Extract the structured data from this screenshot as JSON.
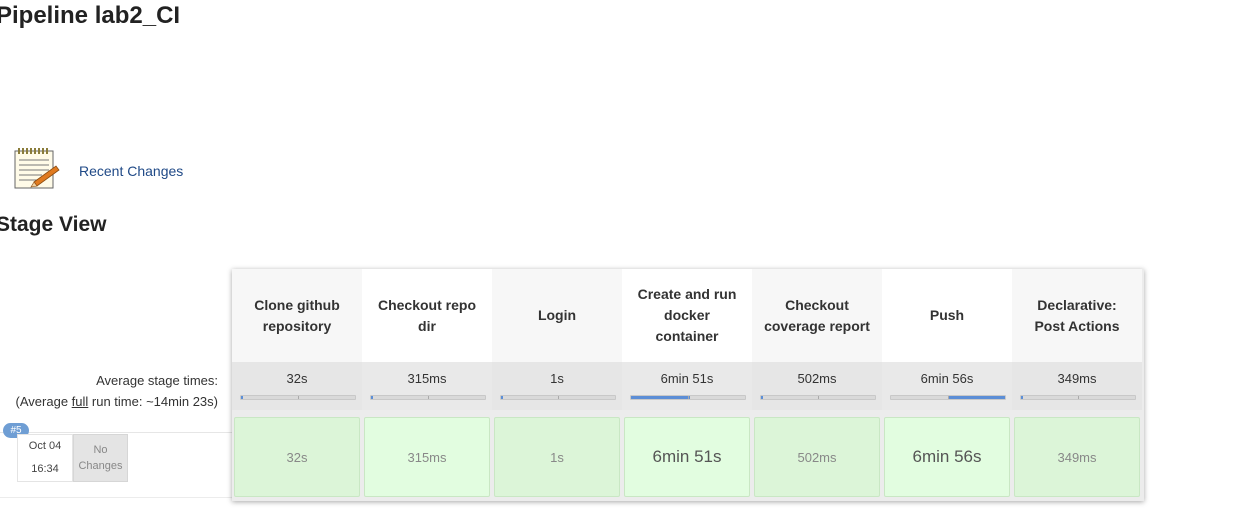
{
  "page": {
    "title": "Pipeline lab2_CI"
  },
  "recent_changes": {
    "label": "Recent Changes",
    "icon": "notepad-pencil-icon"
  },
  "stage_view": {
    "title": "Stage View",
    "average_label_line1": "Average stage times:",
    "average_label_prefix": "(Average ",
    "average_label_full": "full",
    "average_label_suffix": " run time: ~14min 23s)",
    "stages": [
      {
        "name": "Clone github repository",
        "avg": "32s",
        "avg_fraction": 0.01,
        "run": "32s"
      },
      {
        "name": "Checkout repo dir",
        "avg": "315ms",
        "avg_fraction": 0.01,
        "run": "315ms"
      },
      {
        "name": "Login",
        "avg": "1s",
        "avg_fraction": 0.01,
        "run": "1s"
      },
      {
        "name": "Create and run docker container",
        "avg": "6min 51s",
        "avg_fraction": 0.52,
        "run": "6min 51s"
      },
      {
        "name": "Checkout coverage report",
        "avg": "502ms",
        "avg_fraction": 0.01,
        "run": "502ms"
      },
      {
        "name": "Push",
        "avg": "6min 56s",
        "avg_fraction": 0.5,
        "run": "6min 56s"
      },
      {
        "name": "Declarative: Post Actions",
        "avg": "349ms",
        "avg_fraction": 0.01,
        "run": "349ms"
      }
    ]
  },
  "build": {
    "number": "#5",
    "date": "Oct 04",
    "time": "16:34",
    "changes": "No Changes"
  },
  "colors": {
    "link": "#204a87",
    "success_bg": "#dcf5d8",
    "badge": "#6f9ed4",
    "bar_fill": "#5c8ed6"
  }
}
